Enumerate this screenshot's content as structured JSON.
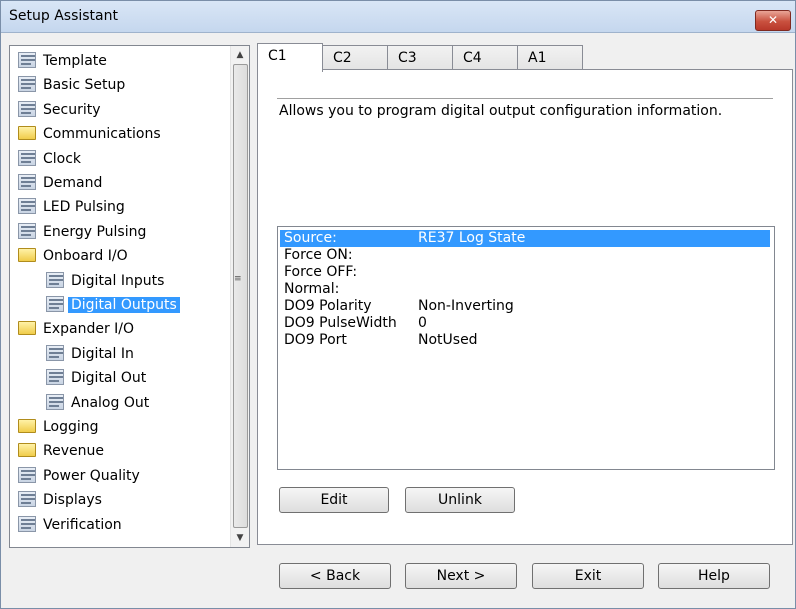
{
  "window": {
    "title": "Setup Assistant",
    "close_glyph": "✕"
  },
  "tree": {
    "items": [
      {
        "label": "Template",
        "icon": "doc",
        "level": 0
      },
      {
        "label": "Basic Setup",
        "icon": "doc",
        "level": 0
      },
      {
        "label": "Security",
        "icon": "doc",
        "level": 0
      },
      {
        "label": "Communications",
        "icon": "folder",
        "level": 0
      },
      {
        "label": "Clock",
        "icon": "doc",
        "level": 0
      },
      {
        "label": "Demand",
        "icon": "doc",
        "level": 0
      },
      {
        "label": "LED Pulsing",
        "icon": "doc",
        "level": 0
      },
      {
        "label": "Energy Pulsing",
        "icon": "doc",
        "level": 0
      },
      {
        "label": "Onboard I/O",
        "icon": "folder",
        "level": 0
      },
      {
        "label": "Digital Inputs",
        "icon": "doc",
        "level": 1
      },
      {
        "label": "Digital Outputs",
        "icon": "doc",
        "level": 1,
        "selected": true
      },
      {
        "label": "Expander I/O",
        "icon": "folder",
        "level": 0
      },
      {
        "label": "Digital In",
        "icon": "doc",
        "level": 1
      },
      {
        "label": "Digital Out",
        "icon": "doc",
        "level": 1
      },
      {
        "label": "Analog Out",
        "icon": "doc",
        "level": 1
      },
      {
        "label": "Logging",
        "icon": "folder",
        "level": 0
      },
      {
        "label": "Revenue",
        "icon": "folder",
        "level": 0
      },
      {
        "label": "Power Quality",
        "icon": "doc",
        "level": 0
      },
      {
        "label": "Displays",
        "icon": "doc",
        "level": 0
      },
      {
        "label": "Verification",
        "icon": "doc",
        "level": 0
      }
    ],
    "scroll_up_glyph": "▲",
    "scroll_down_glyph": "▼",
    "grip_glyph": "≡"
  },
  "tabs": [
    {
      "label": "C1",
      "active": true
    },
    {
      "label": "C2"
    },
    {
      "label": "C3"
    },
    {
      "label": "C4"
    },
    {
      "label": "A1"
    }
  ],
  "description": "Allows you to program digital output configuration information.",
  "properties": [
    {
      "name": "Source:",
      "value": "RE37 Log State",
      "selected": true
    },
    {
      "name": "Force ON:",
      "value": ""
    },
    {
      "name": "Force OFF:",
      "value": ""
    },
    {
      "name": "Normal:",
      "value": ""
    },
    {
      "name": "DO9 Polarity",
      "value": "Non-Inverting"
    },
    {
      "name": "DO9 PulseWidth",
      "value": "0"
    },
    {
      "name": "DO9 Port",
      "value": "NotUsed"
    }
  ],
  "panel_buttons": {
    "edit": "Edit",
    "unlink": "Unlink"
  },
  "footer_buttons": {
    "back": "< Back",
    "next": "Next >",
    "exit": "Exit",
    "help": "Help"
  },
  "colors": {
    "selection": "#3399ff",
    "title_bar": "#c5d7ee",
    "close": "#c9513f"
  }
}
